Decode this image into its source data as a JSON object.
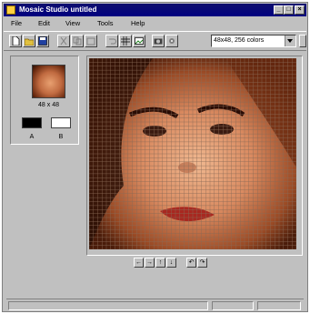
{
  "window": {
    "title": "Mosaic Studio untitled",
    "minimize_glyph": "_",
    "maximize_glyph": "□",
    "close_glyph": "×"
  },
  "menu": [
    "File",
    "Edit",
    "View",
    "Tools",
    "Help"
  ],
  "toolbar": {
    "tools": [
      "new-file-icon",
      "open-folder-icon",
      "save-icon",
      "cut-icon",
      "copy-icon",
      "paste-icon",
      "undo-icon",
      "grid-icon",
      "camera-icon",
      "settings-icon"
    ],
    "palette_value": "48x48, 256 colors",
    "go_icon": "apply-icon"
  },
  "preview": {
    "size_label": "48 x 48",
    "color_a_label": "A",
    "color_b_label": "B",
    "color_a": "#000000",
    "color_b": "#ffffff"
  },
  "mosaic": {
    "grid_columns": 48,
    "grid_rows": 48,
    "grid_color": "#8a6a55"
  },
  "nav_buttons": [
    "←",
    "→",
    "↑",
    "↓",
    "↶",
    "↷"
  ],
  "status": [
    "",
    "",
    ""
  ]
}
